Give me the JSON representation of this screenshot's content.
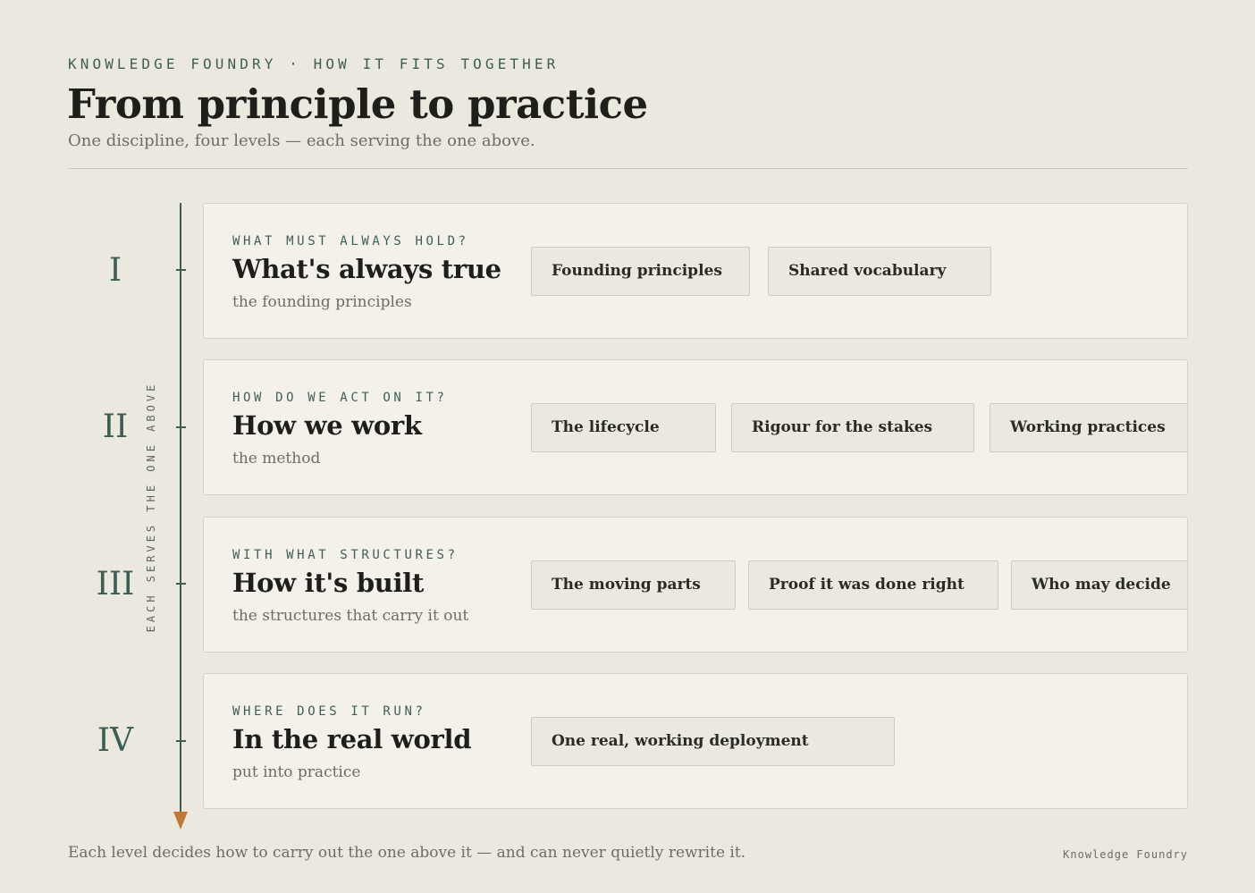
{
  "header": {
    "eyebrow": "KNOWLEDGE FOUNDRY · HOW IT FITS TOGETHER",
    "title": "From principle to practice",
    "subtitle": "One discipline, four levels — each serving the one above."
  },
  "axis": {
    "label": "EACH SERVES THE ONE ABOVE"
  },
  "levels": [
    {
      "numeral": "I",
      "question": "WHAT MUST ALWAYS HOLD?",
      "name": "What's always true",
      "desc": "the founding principles",
      "chips": [
        "Founding principles",
        "Shared vocabulary"
      ]
    },
    {
      "numeral": "II",
      "question": "HOW DO WE ACT ON IT?",
      "name": "How we work",
      "desc": "the method",
      "chips": [
        "The lifecycle",
        "Rigour for the stakes",
        "Working practices"
      ]
    },
    {
      "numeral": "III",
      "question": "WITH WHAT STRUCTURES?",
      "name": "How it's built",
      "desc": "the structures that carry it out",
      "chips": [
        "The moving parts",
        "Proof it was done right",
        "Who may decide"
      ]
    },
    {
      "numeral": "IV",
      "question": "WHERE DOES IT RUN?",
      "name": "In the real world",
      "desc": "put into practice",
      "chips": [
        "One real, working deployment"
      ]
    }
  ],
  "footer": {
    "note": "Each level decides how to carry out the one above it — and can never quietly rewrite it.",
    "brand": "Knowledge Foundry"
  },
  "colors": {
    "background": "#ebe8e0",
    "card": "#f3f1ea",
    "accent_green": "#3d5c52",
    "arrow_orange": "#c07838"
  }
}
